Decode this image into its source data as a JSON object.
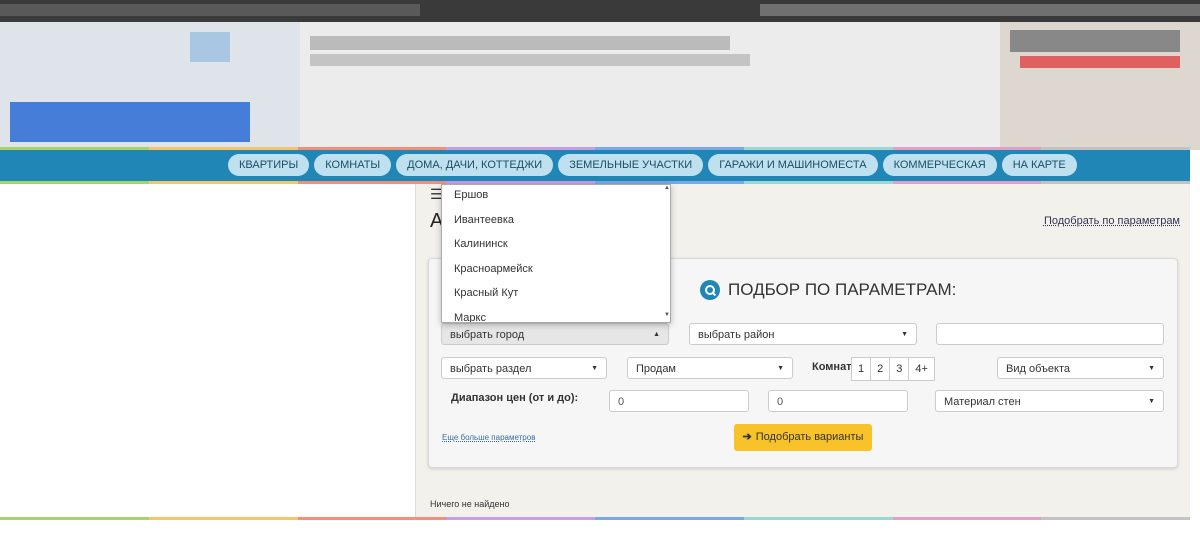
{
  "colors": {
    "menubar": "#1f86b5",
    "menu_pill": "#bfe1ef",
    "submit": "#f8c22b",
    "rainbow": [
      "#a6d36a",
      "#f6c56b",
      "#f0907a",
      "#c79de6",
      "#7aa7e6",
      "#9ad9d3",
      "#e0a0c8",
      "#c3c3c3"
    ]
  },
  "nav": {
    "items": [
      "КВАРТИРЫ",
      "КОМНАТЫ",
      "ДОМА, ДАЧИ, КОТТЕДЖИ",
      "ЗЕМЕЛЬНЫЕ УЧАСТКИ",
      "ГАРАЖИ И МАШИНОМЕСТА",
      "КОММЕРЧЕСКАЯ",
      "НА КАРТЕ"
    ]
  },
  "page": {
    "heading_partial": "А",
    "param_link": "Подобрать по параметрам",
    "not_found": "Ничего не найдено",
    "menu_icon": "hamburger-icon"
  },
  "filter": {
    "title": "ПОДБОР ПО ПАРАМЕТРАМ:",
    "city_select": "выбрать город",
    "district_select": "выбрать район",
    "section_select": "выбрать раздел",
    "deal_select": "Продам",
    "rooms_label": "Комнат:",
    "rooms": [
      "1",
      "2",
      "3",
      "4+"
    ],
    "object_type": "Вид объекта",
    "price_label": "Диапазон цен (от и до):",
    "price_from": "0",
    "price_to": "0",
    "wall_material": "Материал стен",
    "more_params": "Еще больше параметров",
    "submit": "Подобрать варианты",
    "keyword_input": ""
  },
  "city_dropdown": {
    "options": [
      "Ершов",
      "Ивантеевка",
      "Калининск",
      "Красноармейск",
      "Красный Кут",
      "Маркс"
    ]
  }
}
